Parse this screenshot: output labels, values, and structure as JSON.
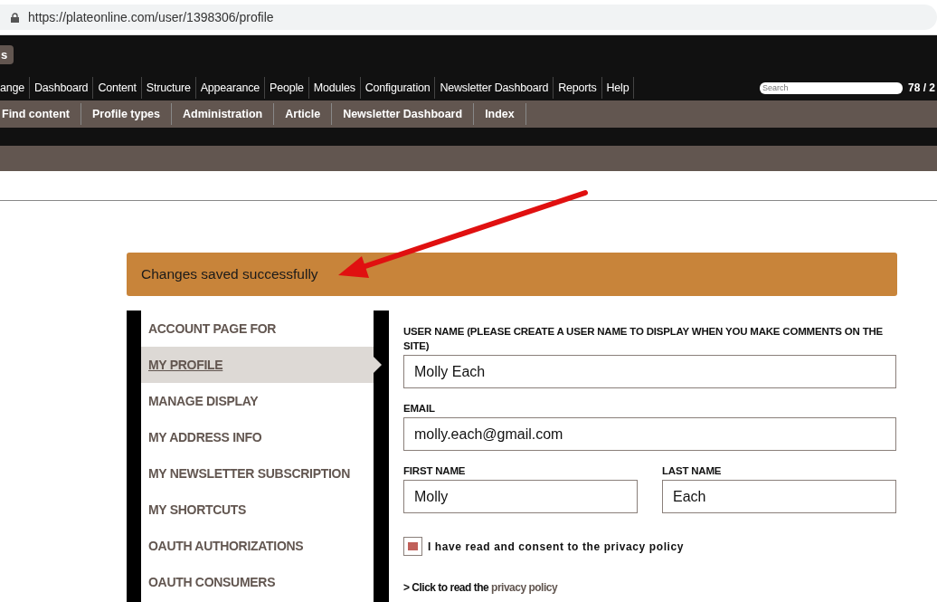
{
  "address_bar": {
    "url": "https://plateonline.com/user/1398306/profile"
  },
  "toolbar": {
    "button": "s",
    "menu": [
      "ange",
      "Dashboard",
      "Content",
      "Structure",
      "Appearance",
      "People",
      "Modules",
      "Configuration",
      "Newsletter Dashboard",
      "Reports",
      "Help"
    ],
    "search": {
      "placeholder": "Search"
    },
    "counter": "78 / 2"
  },
  "shortcuts": [
    "Find content",
    "Profile types",
    "Administration",
    "Article",
    "Newsletter Dashboard",
    "Index"
  ],
  "message": "Changes saved successfully",
  "sidebar": {
    "items": [
      {
        "label": "ACCOUNT PAGE FOR",
        "selected": false
      },
      {
        "label": "MY PROFILE",
        "selected": true
      },
      {
        "label": "MANAGE DISPLAY",
        "selected": false
      },
      {
        "label": "MY ADDRESS INFO",
        "selected": false
      },
      {
        "label": "MY NEWSLETTER SUBSCRIPTION",
        "selected": false
      },
      {
        "label": "MY SHORTCUTS",
        "selected": false
      },
      {
        "label": "OAUTH AUTHORIZATIONS",
        "selected": false
      },
      {
        "label": "OAUTH CONSUMERS",
        "selected": false
      }
    ]
  },
  "form": {
    "user_name": {
      "label": "USER NAME (PLEASE CREATE A USER NAME TO DISPLAY WHEN YOU MAKE COMMENTS ON THE SITE)",
      "value": "Molly Each"
    },
    "email": {
      "label": "EMAIL",
      "value": "molly.each@gmail.com"
    },
    "first_name": {
      "label": "FIRST NAME",
      "value": "Molly"
    },
    "last_name": {
      "label": "LAST NAME",
      "value": "Each"
    },
    "consent": {
      "label": "I have read and consent to the privacy policy",
      "checked": true
    },
    "privacy": {
      "prefix": "> Click to read the",
      "link": "privacy policy"
    }
  }
}
